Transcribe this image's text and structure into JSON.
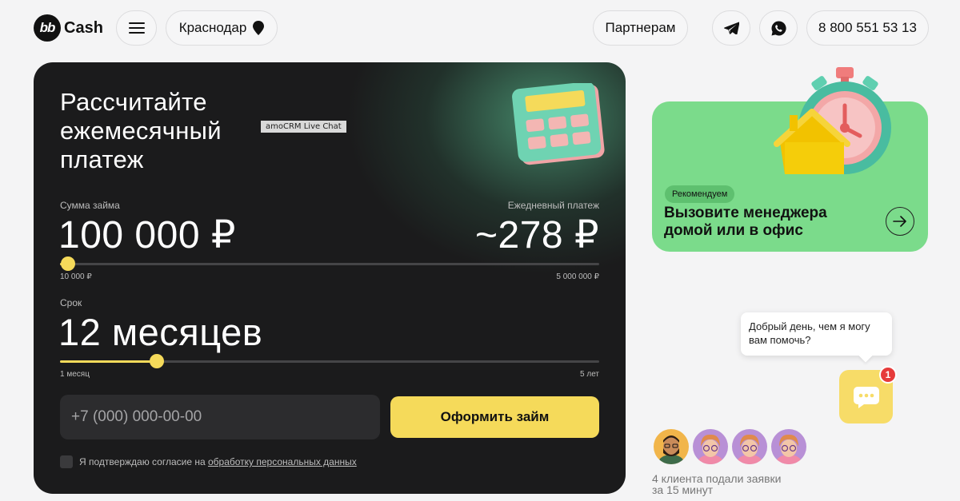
{
  "header": {
    "logo_badge": "bb",
    "logo_text": "Cash",
    "city": "Краснодар",
    "partners": "Партнерам",
    "phone": "8 800 551 53 13"
  },
  "calculator": {
    "title_lines": [
      "Рассчитайте",
      "ежемесячный",
      "платеж"
    ],
    "widget_tag": "amoCRM Live Chat",
    "amount_label": "Сумма займа",
    "amount_value": "100 000 ₽",
    "payment_label": "Ежедневный платеж",
    "payment_value": "~278 ₽",
    "amount_min": "10 000 ₽",
    "amount_max": "5 000 000 ₽",
    "amount_slider_fraction": 0.0,
    "term_label": "Срок",
    "term_value": "12 месяцев",
    "term_min": "1 месяц",
    "term_max": "5 лет",
    "term_slider_fraction": 0.18,
    "phone_placeholder": "+7 (000) 000-00-00",
    "submit_label": "Оформить займ",
    "consent_text": "Я подтверждаю согласие на ",
    "consent_link": "обработку персональных данных",
    "consent_checked": false
  },
  "promo": {
    "badge": "Рекомендуем",
    "title": "Вызовите менеджера домой или в офис"
  },
  "chat": {
    "greeting": "Добрый день, чем я могу вам помочь?",
    "unread_count": "1"
  },
  "social_proof": {
    "line1": "4 клиента подали заявки",
    "line2": "за 15 минут"
  },
  "colors": {
    "accent_yellow": "#f5da5a",
    "card_dark": "#1b1b1c",
    "promo_green": "#7bdb8b",
    "badge_red": "#e63b3b"
  },
  "icons": [
    "menu-icon",
    "location-pin-icon",
    "telegram-icon",
    "whatsapp-icon",
    "arrow-right-icon",
    "chat-icon"
  ]
}
